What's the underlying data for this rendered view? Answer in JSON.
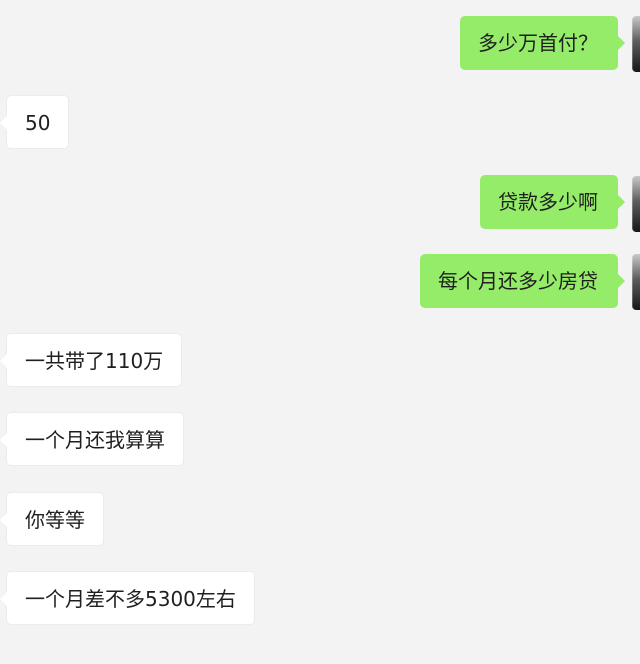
{
  "messages": [
    {
      "side": "out",
      "text": "多少万首付？"
    },
    {
      "side": "in",
      "text": "50"
    },
    {
      "side": "out",
      "text": "贷款多少啊"
    },
    {
      "side": "out",
      "text": "每个月还多少房贷"
    },
    {
      "side": "in",
      "text": "一共带了110万"
    },
    {
      "side": "in",
      "text": "一个月还我算算"
    },
    {
      "side": "in",
      "text": "你等等"
    },
    {
      "side": "in",
      "text": "一个月差不多5300左右"
    }
  ],
  "colors": {
    "background": "#f3f3f3",
    "outgoing_bubble": "#95ec69",
    "incoming_bubble": "#ffffff",
    "text": "#1f1f1f"
  }
}
